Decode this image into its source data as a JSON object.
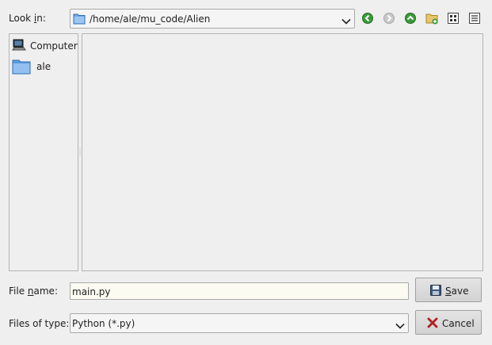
{
  "look_in": {
    "label_pre": "Look ",
    "label_mnemonic": "i",
    "label_post": "n:",
    "path": "/home/ale/mu_code/Alien"
  },
  "toolbar": {
    "back_icon": "back-arrow-icon",
    "forward_icon": "forward-arrow-icon",
    "parent_icon": "up-arrow-icon",
    "new_folder_icon": "new-folder-icon",
    "list_view_icon": "list-view-icon",
    "detail_view_icon": "detail-view-icon"
  },
  "sidebar": {
    "items": [
      {
        "label": "Computer",
        "icon": "computer-icon"
      },
      {
        "label": "ale",
        "icon": "folder-icon"
      }
    ]
  },
  "file_name": {
    "label_pre": "File ",
    "label_mnemonic": "n",
    "label_post": "ame:",
    "value": "main.py"
  },
  "file_type": {
    "label": "Files of type:",
    "value": "Python (*.py)"
  },
  "buttons": {
    "save_mnemonic": "S",
    "save_rest": "ave",
    "cancel": "Cancel"
  },
  "colors": {
    "background": "#efefef",
    "input_bg": "#fbfbf2",
    "nav_green": "#3a9a3a",
    "folder_blue": "#4a8fd8"
  }
}
